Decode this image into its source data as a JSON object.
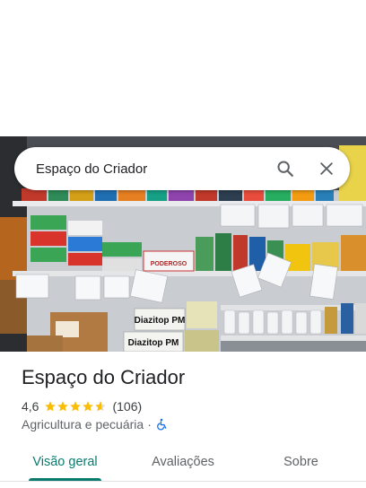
{
  "search": {
    "query": "Espaço do Criador"
  },
  "icons": {
    "search": "search-icon",
    "close": "close-icon",
    "accessibility": "wheelchair-icon",
    "star": "star-icon"
  },
  "place": {
    "name": "Espaço do Criador",
    "rating": "4,6",
    "rating_value": 4.6,
    "review_count": "(106)",
    "category": "Agricultura e pecuária",
    "separator": "·"
  },
  "photo_signs": {
    "sign1": "PODEROSO",
    "sign2": "Diazitop PM",
    "sign3": "Diazitop PM"
  },
  "tabs": [
    {
      "label": "Visão geral",
      "active": true
    },
    {
      "label": "Avaliações",
      "active": false
    },
    {
      "label": "Sobre",
      "active": false
    }
  ],
  "colors": {
    "accent": "#0b7a6e",
    "star": "#fbbc04",
    "accessibility": "#1a73e8"
  }
}
